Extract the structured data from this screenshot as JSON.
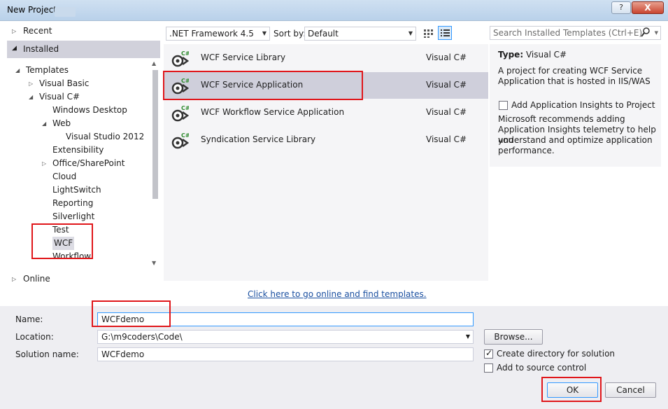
{
  "window": {
    "title": "New Project",
    "help_label": "?",
    "close_label": "X"
  },
  "left": {
    "recent": "Recent",
    "installed": "Installed",
    "online": "Online",
    "tree": [
      {
        "label": "Templates",
        "level": 0,
        "arrow": "open"
      },
      {
        "label": "Visual Basic",
        "level": 1,
        "arrow": "closed"
      },
      {
        "label": "Visual C#",
        "level": 1,
        "arrow": "open"
      },
      {
        "label": "Windows Desktop",
        "level": 2,
        "arrow": "none"
      },
      {
        "label": "Web",
        "level": 2,
        "arrow": "open"
      },
      {
        "label": "Visual Studio 2012",
        "level": 3,
        "arrow": "none"
      },
      {
        "label": "Extensibility",
        "level": 2,
        "arrow": "none"
      },
      {
        "label": "Office/SharePoint",
        "level": 2,
        "arrow": "closed"
      },
      {
        "label": "Cloud",
        "level": 2,
        "arrow": "none"
      },
      {
        "label": "LightSwitch",
        "level": 2,
        "arrow": "none"
      },
      {
        "label": "Reporting",
        "level": 2,
        "arrow": "none"
      },
      {
        "label": "Silverlight",
        "level": 2,
        "arrow": "none"
      },
      {
        "label": "Test",
        "level": 2,
        "arrow": "none"
      },
      {
        "label": "WCF",
        "level": 2,
        "arrow": "none"
      },
      {
        "label": "Workflow",
        "level": 2,
        "arrow": "none"
      }
    ]
  },
  "toolbar": {
    "framework": ".NET Framework 4.5",
    "sort_label": "Sort by:",
    "sort_value": "Default"
  },
  "templates": [
    {
      "name": "WCF Service Library",
      "lang": "Visual C#",
      "selected": false
    },
    {
      "name": "WCF Service Application",
      "lang": "Visual C#",
      "selected": true
    },
    {
      "name": "WCF Workflow Service Application",
      "lang": "Visual C#",
      "selected": false
    },
    {
      "name": "Syndication Service Library",
      "lang": "Visual C#",
      "selected": false
    }
  ],
  "online_link": "Click here to go online and find templates.",
  "search": {
    "placeholder": "Search Installed Templates (Ctrl+E)"
  },
  "details": {
    "type_label": "Type:",
    "type_value": "Visual C#",
    "description_line1": "A project for creating WCF Service",
    "description_line2": "Application that is hosted in IIS/WAS",
    "insights_label": "Add Application Insights to Project",
    "insights_line1": "Microsoft recommends adding",
    "insights_line2": "Application Insights telemetry to help you",
    "insights_line3": "understand and optimize application",
    "insights_line4": "performance."
  },
  "form": {
    "name_label": "Name:",
    "name_value": "WCFdemo",
    "location_label": "Location:",
    "location_value": "G:\\m9coders\\Code\\",
    "solution_label": "Solution name:",
    "solution_value": "WCFdemo",
    "browse_label": "Browse...",
    "create_dir_label": "Create directory for solution",
    "create_dir_checked": true,
    "source_control_label": "Add to source control",
    "source_control_checked": false,
    "ok_label": "OK",
    "cancel_label": "Cancel"
  },
  "colors": {
    "highlight": "#e0161a",
    "selected_row": "#cfcfdb",
    "link": "#1a4fa0"
  }
}
